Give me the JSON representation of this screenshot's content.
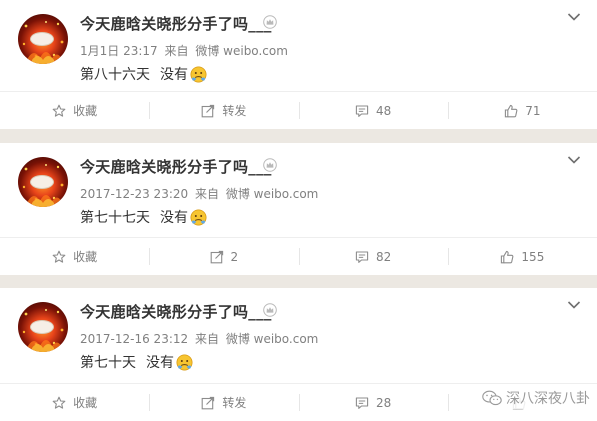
{
  "posts": [
    {
      "username": "今天鹿晗关晓彤分手了吗___",
      "time": "1月1日 23:17",
      "via": "来自",
      "source": "微博 weibo.com",
      "text_main": "第八十六天",
      "text_tail": "没有",
      "actions": {
        "favorite": "收藏",
        "repost": "转发",
        "comment": "48",
        "like": "71"
      }
    },
    {
      "username": "今天鹿晗关晓彤分手了吗___",
      "time": "2017-12-23 23:20",
      "via": "来自",
      "source": "微博 weibo.com",
      "text_main": "第七十七天",
      "text_tail": "没有",
      "actions": {
        "favorite": "收藏",
        "repost": "2",
        "comment": "82",
        "like": "155"
      }
    },
    {
      "username": "今天鹿晗关晓彤分手了吗___",
      "time": "2017-12-16 23:12",
      "via": "来自",
      "source": "微博 weibo.com",
      "text_main": "第七十天",
      "text_tail": "没有",
      "actions": {
        "favorite": "收藏",
        "repost": "转发",
        "comment": "28",
        "like": ""
      }
    }
  ],
  "watermark": "深八深夜八卦",
  "icons": {
    "verified": "crown-icon",
    "menu": "chevron-down-icon",
    "favorite": "star-icon",
    "repost": "repost-icon",
    "comment": "comment-icon",
    "like": "thumb-up-icon",
    "emoji": "thinking-face-icon",
    "watermark": "wechat-icon"
  },
  "colors": {
    "username": "#333333",
    "meta": "#808080",
    "separator": "#ece8e2",
    "emoji": "#f7c531"
  }
}
